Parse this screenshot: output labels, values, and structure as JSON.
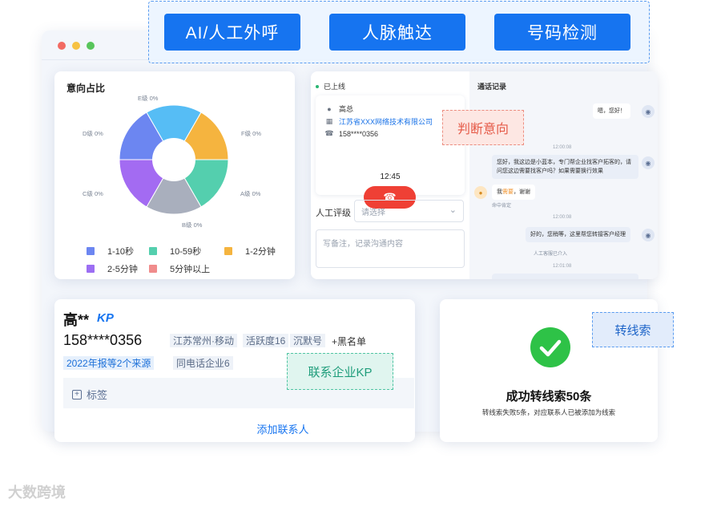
{
  "banner": {
    "buttons": [
      "AI/人工外呼",
      "人脉触达",
      "号码检测"
    ]
  },
  "pie": {
    "title": "意向占比",
    "slice_labels": [
      "A级 0%",
      "B级 0%",
      "C级 0%",
      "D级 0%",
      "E级 0%",
      "F级 0%"
    ],
    "legend": [
      "1-10秒",
      "10-59秒",
      "1-2分钟",
      "2-5分钟",
      "5分钟以上"
    ],
    "colors": [
      "#54cfae",
      "#a9afbd",
      "#a36bf2",
      "#6c86f1",
      "#56bdf5",
      "#f5b43f"
    ],
    "legend_colors": [
      "#6c86f1",
      "#54cfae",
      "#f5b43f",
      "#9c6ef3",
      "#f08c8c"
    ]
  },
  "call": {
    "status": "已上线",
    "contact_name": "高总",
    "company": "江苏省XXX网络技术有限公司",
    "phone": "158****0356",
    "timer": "12:45",
    "rating_label": "人工评级",
    "rating_placeholder": "请选择",
    "note_placeholder": "写备注，记录沟通内容",
    "judge_tag": "判断意向"
  },
  "record": {
    "title": "通话记录",
    "msg1": "嗯，您好！",
    "ts1": "12:00:08",
    "msg2": "您好，我这边是小蓝本，专门帮企业找客户拓客的，请问您这边需要找客户吗？如果需要换行效果",
    "msg3_prefix": "我",
    "msg3_highlight": "需要",
    "msg3_suffix": "，谢谢",
    "msg3_note": "命中肯定",
    "ts2": "12:00:08",
    "msg4": "好的，您稍等，这里帮您转接客户经理",
    "system_note": "人工客服已介入",
    "ts3": "12:01:08",
    "agent_icon": "robot-icon",
    "user_icon": "user-icon"
  },
  "lead": {
    "name": "高**",
    "kp": "KP",
    "phone": "158****0356",
    "tags_row1": [
      "江苏常州·移动",
      "活跃度16",
      "沉默号"
    ],
    "blacklist": "+黑名单",
    "tags_row2": [
      "2022年报等2个来源",
      "同电话企业6"
    ],
    "label_btn": "标签",
    "add_contact": "添加联系人",
    "kp_tag": "联系企业KP"
  },
  "success": {
    "title": "成功转线索50条",
    "subtitle": "转线索失败5条，对应联系人已被添加为线索",
    "transfer_tag": "转线索",
    "check_color": "#2ec247"
  },
  "watermark": "大数跨境"
}
